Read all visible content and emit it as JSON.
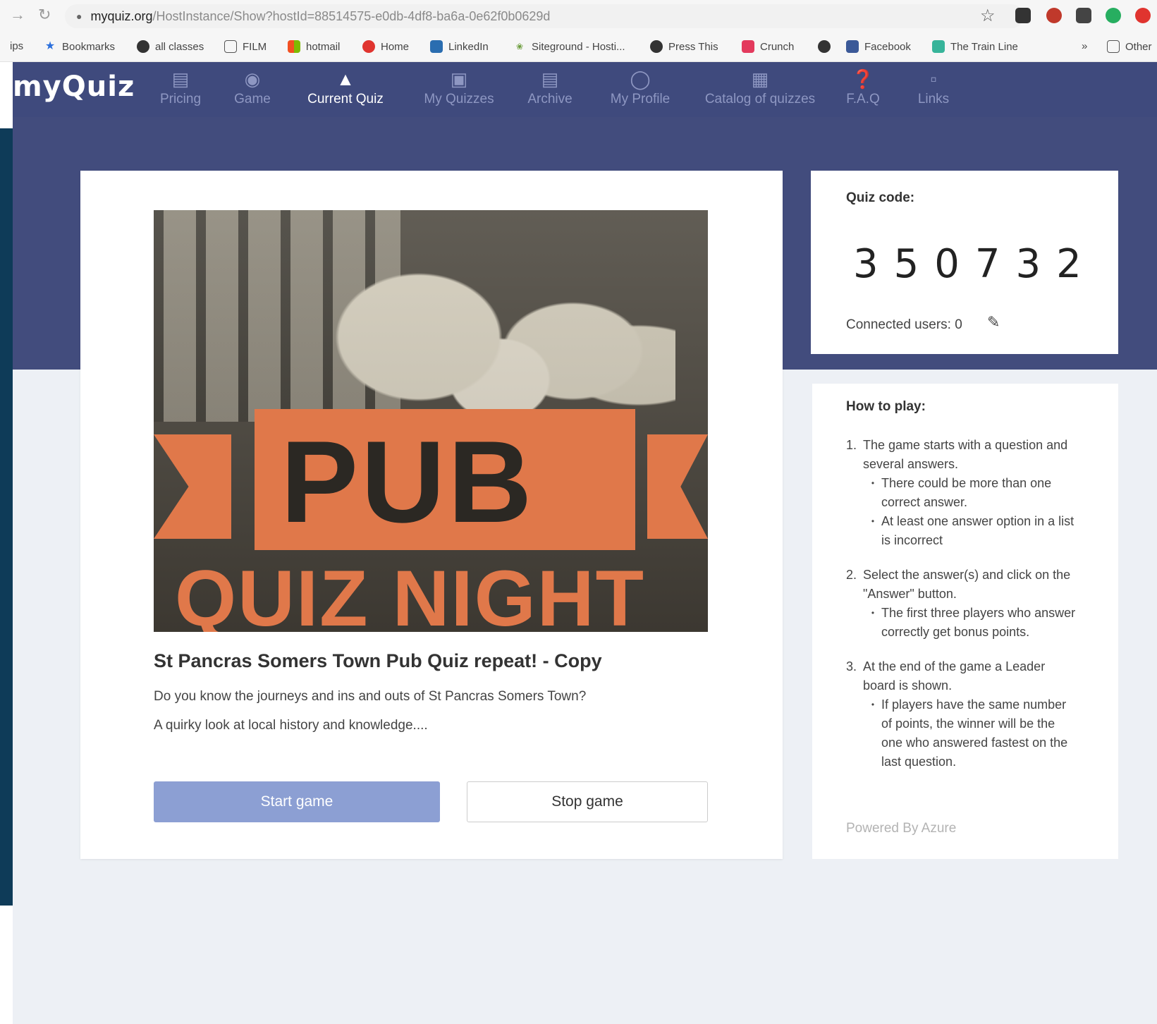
{
  "browser": {
    "url_host": "myquiz.org",
    "url_path": "/HostInstance/Show?hostId=88514575-e0db-4df8-ba6a-0e62f0b0629d",
    "bookmarks": [
      {
        "label": "ips",
        "icon": "apps-icon"
      },
      {
        "label": "Bookmarks",
        "icon": "star-icon"
      },
      {
        "label": "all classes",
        "icon": "globe-icon"
      },
      {
        "label": "FILM",
        "icon": "folder-icon"
      },
      {
        "label": "hotmail",
        "icon": "windows-icon"
      },
      {
        "label": "Home",
        "icon": "pinterest-icon"
      },
      {
        "label": "LinkedIn",
        "icon": "linkedin-icon"
      },
      {
        "label": "Siteground - Hosti...",
        "icon": "siteground-icon"
      },
      {
        "label": "Press This",
        "icon": "globe-icon"
      },
      {
        "label": "Crunch",
        "icon": "crunch-icon"
      },
      {
        "label": "",
        "icon": "globe-icon"
      },
      {
        "label": "Facebook",
        "icon": "facebook-icon"
      },
      {
        "label": "The Train Line",
        "icon": "trainline-icon"
      },
      {
        "label": "»",
        "icon": ""
      },
      {
        "label": "Other",
        "icon": "folder-icon"
      }
    ]
  },
  "app": {
    "logo": "myQuiz",
    "nav": [
      {
        "label": "Pricing",
        "icon": "card-icon",
        "active": false
      },
      {
        "label": "Game",
        "icon": "gamepad-icon",
        "active": false
      },
      {
        "label": "Current Quiz",
        "icon": "flask-icon",
        "active": true
      },
      {
        "label": "My Quizzes",
        "icon": "quiz-stack-icon",
        "active": false
      },
      {
        "label": "Archive",
        "icon": "archive-icon",
        "active": false
      },
      {
        "label": "My Profile",
        "icon": "user-icon",
        "active": false
      },
      {
        "label": "Catalog of quizzes",
        "icon": "catalog-icon",
        "active": false
      },
      {
        "label": "F.A.Q",
        "icon": "question-icon",
        "active": false
      },
      {
        "label": "Links",
        "icon": "bookmark-icon",
        "active": false
      }
    ]
  },
  "quiz": {
    "title": "St Pancras Somers Town Pub Quiz repeat! - Copy",
    "description_1": "Do you know the journeys and ins and outs of St Pancras Somers Town?",
    "description_2": "A quirky look at local history and knowledge....",
    "start_label": "Start game",
    "stop_label": "Stop game",
    "image_text_1": "PUB",
    "image_text_2": "QUIZ NIGHT"
  },
  "code_card": {
    "label": "Quiz code:",
    "code": "350732",
    "connected_label": "Connected users: 0"
  },
  "howto": {
    "title": "How to play:",
    "steps": [
      {
        "num": "1.",
        "text": "The game starts with a question and several answers.",
        "subs": [
          "There could be more than one correct answer.",
          "At least one answer option in a list is incorrect"
        ]
      },
      {
        "num": "2.",
        "text": "Select the answer(s) and click on the \"Answer\" button.",
        "subs": [
          "The first three players who answer correctly get bonus points."
        ]
      },
      {
        "num": "3.",
        "text": "At the end of the game a Leader board is shown.",
        "subs": [
          "If players have the same number of points, the winner will be the one who answered fastest on the last question."
        ]
      }
    ],
    "powered_by": "Powered By Azure"
  },
  "colors": {
    "header": "#3f4a7d",
    "band": "#424c7d",
    "start_button": "#8c9fd3",
    "banner_orange": "#e0784a",
    "page_bg": "#edf0f5"
  }
}
